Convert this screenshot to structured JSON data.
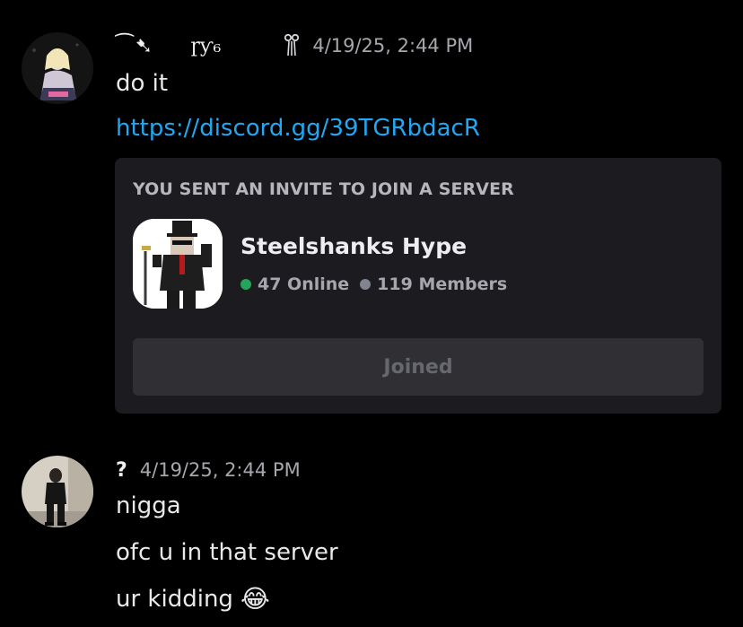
{
  "messages": [
    {
      "username": "⁀➷",
      "tag": "ɼƴ₆",
      "badge_icon": "bow-icon",
      "timestamp": "4/19/25, 2:44 PM",
      "lines": [
        "do it"
      ],
      "link": "https://discord.gg/39TGRbdacR",
      "invite": {
        "heading": "YOU SENT AN INVITE TO JOIN A SERVER",
        "server_name": "Steelshanks Hype",
        "online": "47 Online",
        "members": "119 Members",
        "button_label": "Joined"
      }
    },
    {
      "username": "?",
      "timestamp": "4/19/25, 2:44 PM",
      "lines": [
        "nigga",
        "ofc u in that server",
        "ur kidding"
      ],
      "emoji": "😂",
      "emoji_name": "joy-emoji"
    }
  ],
  "colors": {
    "background": "#000000",
    "link": "#22a7f2",
    "online_dot": "#23a55a",
    "members_dot": "#80848e",
    "embed_bg": "#1c1c20",
    "button_bg": "#2f2f34"
  }
}
